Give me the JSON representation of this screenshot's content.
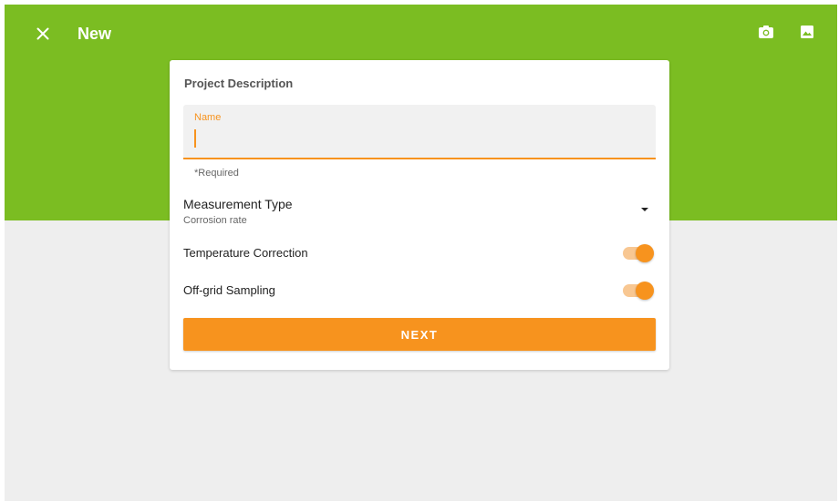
{
  "appbar": {
    "title": "New",
    "close_icon": "close-icon",
    "camera_icon": "camera-icon",
    "gallery_icon": "image-icon",
    "color": "#7bbd22"
  },
  "card": {
    "heading": "Project Description",
    "name_field": {
      "label": "Name",
      "value": "",
      "helper": "*Required"
    },
    "measurement": {
      "title": "Measurement Type",
      "value": "Corrosion rate",
      "icon": "dropdown-arrow-icon"
    },
    "toggles": [
      {
        "label": "Temperature Correction",
        "on": true
      },
      {
        "label": "Off-grid Sampling",
        "on": true
      }
    ],
    "next_label": "NEXT"
  },
  "colors": {
    "accent": "#f7931e",
    "background": "#eeeeee"
  }
}
